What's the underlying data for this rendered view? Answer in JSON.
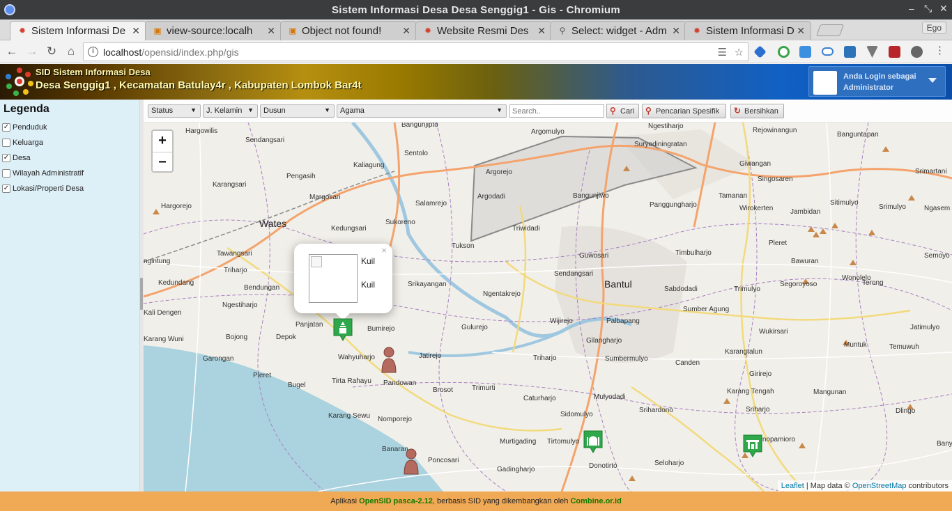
{
  "window": {
    "title": "Sistem Informasi Desa Desa Senggig1 - Gis - Chromium"
  },
  "tabs": [
    {
      "label": "Sistem Informasi De",
      "active": true
    },
    {
      "label": "view-source:localh",
      "active": false
    },
    {
      "label": "Object not found!",
      "active": false
    },
    {
      "label": "Website Resmi Des",
      "active": false
    },
    {
      "label": "Select: widget - Adm",
      "active": false
    },
    {
      "label": "Sistem Informasi De",
      "active": false
    }
  ],
  "profile_name": "Ego",
  "addressbar": {
    "host": "localhost",
    "path": "/opensid/index.php/gis"
  },
  "site": {
    "subtitle": "SID Sistem Informasi Desa",
    "title": "Desa Senggig1 , Kecamatan Batulay4r , Kabupaten Lombok Bar4t",
    "login_line1": "Anda Login sebagai",
    "login_line2": "Administrator"
  },
  "legend": {
    "title": "Legenda",
    "items": [
      {
        "label": "Penduduk",
        "checked": true
      },
      {
        "label": "Keluarga",
        "checked": false
      },
      {
        "label": "Desa",
        "checked": true
      },
      {
        "label": "Wilayah Administratif",
        "checked": false
      },
      {
        "label": "Lokasi/Properti Desa",
        "checked": true
      }
    ]
  },
  "filters": {
    "status": "Status",
    "kelamin": "J. Kelamin",
    "dusun": "Dusun",
    "agama": "Agama",
    "search_placeholder": "Search..",
    "cari": "Cari",
    "spesifik": "Pencarian Spesifik",
    "bersihkan": "Bersihkan"
  },
  "map": {
    "zoom_in": "+",
    "zoom_out": "−",
    "popup_line1": "Kuil",
    "popup_line2": "Kuil",
    "popup_close": "×",
    "big_labels": [
      "Wates",
      "Bantul"
    ],
    "places": [
      "Bangunjipto",
      "Argomulyo",
      "Ngestiharjo",
      "Rejowinangun",
      "Banguntapan",
      "Hargowilis",
      "Sendangsari",
      "Sentolo",
      "Kaliagung",
      "Suryodiningratan",
      "Giwangan",
      "Argorejo",
      "Bangunjiwo",
      "Singosaren",
      "Srimartani",
      "Karangsari",
      "Pengasih",
      "Tamanan",
      "Margosari",
      "Argodadi",
      "Panggungharjo",
      "Wirokerten",
      "Jambidan",
      "Sitimulyo",
      "Srimulyo",
      "Ngasem",
      "Hargorejo",
      "Salamrejo",
      "Sukoreno",
      "Kedungsari",
      "Triwidadi",
      "Tukson",
      "Pleret",
      "Timbulharjo",
      "Semoyo",
      "Tawangsari",
      "Guwosari",
      "Bawuran",
      "Sendangsari",
      "Wonolelo",
      "Triharjo",
      "Srikayangan",
      "Sabdodadi",
      "Trimulyo",
      "Segoroyoso",
      "Terong",
      "ngintung",
      "Kedundang",
      "Bendungan",
      "Ngentakrejo",
      "Ngestiharjo",
      "Sumber Agung",
      "Kali Dengen",
      "Panjatan",
      "Bumirejo",
      "Gulurejo",
      "Wijirejo",
      "Palbapang",
      "Wukirsari",
      "Jatimulyo",
      "Karang Wuni",
      "Bojong",
      "Depok",
      "Wahyuharjo",
      "Jatirejo",
      "Gilangharjo",
      "Triharjo",
      "Sumbermulyo",
      "Canden",
      "Karangtalun",
      "Muntuk",
      "Temuwuh",
      "Garongan",
      "Pleret",
      "Bugel",
      "Tirta Rahayu",
      "Pandowan",
      "Brosot",
      "Trimurti",
      "Caturharjo",
      "Mulyodadi",
      "Girirejo",
      "Karang Tengah",
      "Mangunan",
      "Karang Sewu",
      "Nomporejo",
      "Sidomulyo",
      "Srihardono",
      "Sriharjo",
      "Dlingo",
      "Murtigading",
      "Tirtomulyo",
      "Banaran",
      "Poncosari",
      "Gadingharjo",
      "Donotirto",
      "Seloharjo",
      "Wonopamioro",
      "Banyu"
    ],
    "attribution_leaflet": "Leaflet",
    "attribution_text": "| Map data © ",
    "attribution_osm": "OpenStreetMap",
    "attribution_contrib": " contributors"
  },
  "footer": {
    "prefix": "Aplikasi ",
    "app": "OpenSID pasca-2.12",
    "middle": ", berbasis SID yang dikembangkan oleh ",
    "org": "Combine.or.id"
  },
  "colors": {
    "footer_bg": "#f0a955",
    "sidebar_bg": "#ddeff7",
    "marker_green": "#2ea84a",
    "marker_person": "#b56a5f"
  }
}
